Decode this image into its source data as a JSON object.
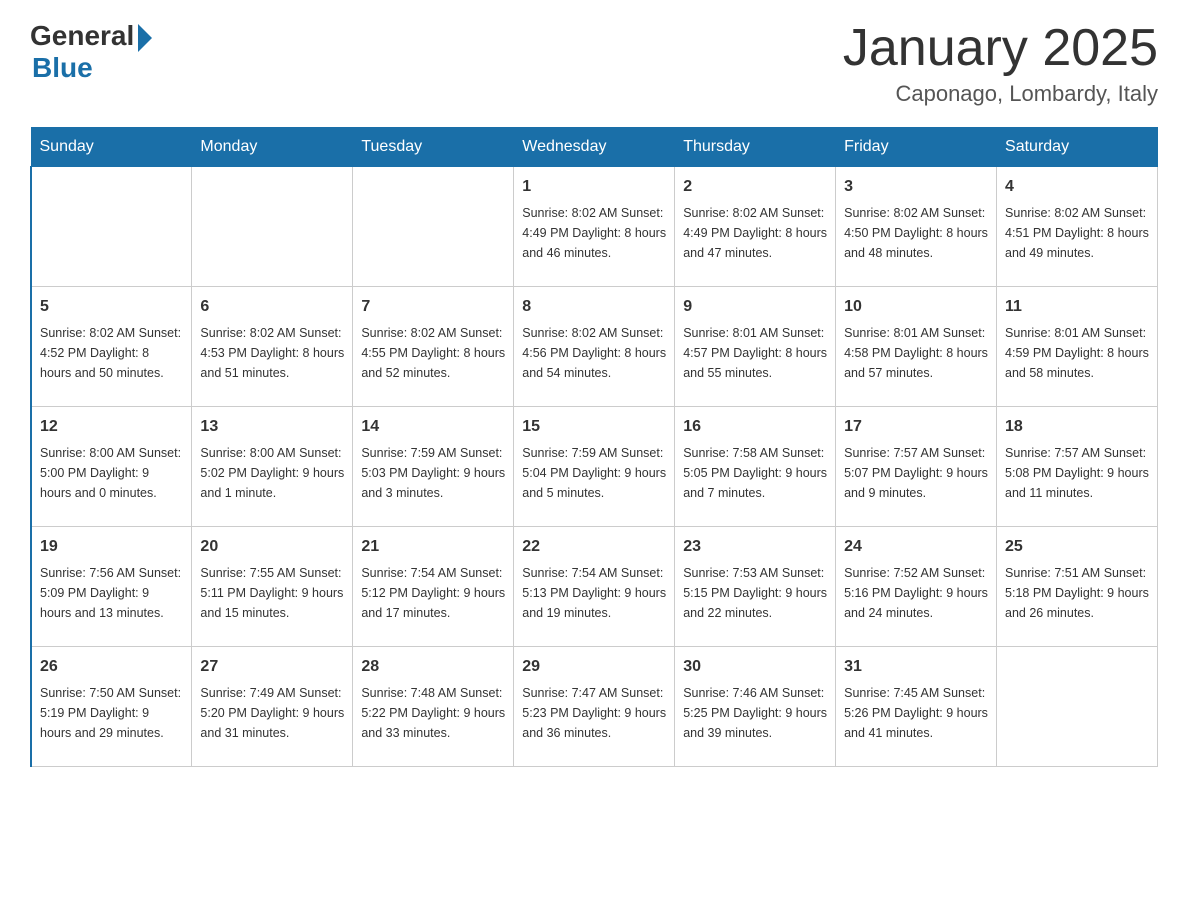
{
  "header": {
    "logo_general": "General",
    "logo_blue": "Blue",
    "month_title": "January 2025",
    "location": "Caponago, Lombardy, Italy"
  },
  "days_of_week": [
    "Sunday",
    "Monday",
    "Tuesday",
    "Wednesday",
    "Thursday",
    "Friday",
    "Saturday"
  ],
  "weeks": [
    [
      {
        "day": "",
        "info": ""
      },
      {
        "day": "",
        "info": ""
      },
      {
        "day": "",
        "info": ""
      },
      {
        "day": "1",
        "info": "Sunrise: 8:02 AM\nSunset: 4:49 PM\nDaylight: 8 hours\nand 46 minutes."
      },
      {
        "day": "2",
        "info": "Sunrise: 8:02 AM\nSunset: 4:49 PM\nDaylight: 8 hours\nand 47 minutes."
      },
      {
        "day": "3",
        "info": "Sunrise: 8:02 AM\nSunset: 4:50 PM\nDaylight: 8 hours\nand 48 minutes."
      },
      {
        "day": "4",
        "info": "Sunrise: 8:02 AM\nSunset: 4:51 PM\nDaylight: 8 hours\nand 49 minutes."
      }
    ],
    [
      {
        "day": "5",
        "info": "Sunrise: 8:02 AM\nSunset: 4:52 PM\nDaylight: 8 hours\nand 50 minutes."
      },
      {
        "day": "6",
        "info": "Sunrise: 8:02 AM\nSunset: 4:53 PM\nDaylight: 8 hours\nand 51 minutes."
      },
      {
        "day": "7",
        "info": "Sunrise: 8:02 AM\nSunset: 4:55 PM\nDaylight: 8 hours\nand 52 minutes."
      },
      {
        "day": "8",
        "info": "Sunrise: 8:02 AM\nSunset: 4:56 PM\nDaylight: 8 hours\nand 54 minutes."
      },
      {
        "day": "9",
        "info": "Sunrise: 8:01 AM\nSunset: 4:57 PM\nDaylight: 8 hours\nand 55 minutes."
      },
      {
        "day": "10",
        "info": "Sunrise: 8:01 AM\nSunset: 4:58 PM\nDaylight: 8 hours\nand 57 minutes."
      },
      {
        "day": "11",
        "info": "Sunrise: 8:01 AM\nSunset: 4:59 PM\nDaylight: 8 hours\nand 58 minutes."
      }
    ],
    [
      {
        "day": "12",
        "info": "Sunrise: 8:00 AM\nSunset: 5:00 PM\nDaylight: 9 hours\nand 0 minutes."
      },
      {
        "day": "13",
        "info": "Sunrise: 8:00 AM\nSunset: 5:02 PM\nDaylight: 9 hours\nand 1 minute."
      },
      {
        "day": "14",
        "info": "Sunrise: 7:59 AM\nSunset: 5:03 PM\nDaylight: 9 hours\nand 3 minutes."
      },
      {
        "day": "15",
        "info": "Sunrise: 7:59 AM\nSunset: 5:04 PM\nDaylight: 9 hours\nand 5 minutes."
      },
      {
        "day": "16",
        "info": "Sunrise: 7:58 AM\nSunset: 5:05 PM\nDaylight: 9 hours\nand 7 minutes."
      },
      {
        "day": "17",
        "info": "Sunrise: 7:57 AM\nSunset: 5:07 PM\nDaylight: 9 hours\nand 9 minutes."
      },
      {
        "day": "18",
        "info": "Sunrise: 7:57 AM\nSunset: 5:08 PM\nDaylight: 9 hours\nand 11 minutes."
      }
    ],
    [
      {
        "day": "19",
        "info": "Sunrise: 7:56 AM\nSunset: 5:09 PM\nDaylight: 9 hours\nand 13 minutes."
      },
      {
        "day": "20",
        "info": "Sunrise: 7:55 AM\nSunset: 5:11 PM\nDaylight: 9 hours\nand 15 minutes."
      },
      {
        "day": "21",
        "info": "Sunrise: 7:54 AM\nSunset: 5:12 PM\nDaylight: 9 hours\nand 17 minutes."
      },
      {
        "day": "22",
        "info": "Sunrise: 7:54 AM\nSunset: 5:13 PM\nDaylight: 9 hours\nand 19 minutes."
      },
      {
        "day": "23",
        "info": "Sunrise: 7:53 AM\nSunset: 5:15 PM\nDaylight: 9 hours\nand 22 minutes."
      },
      {
        "day": "24",
        "info": "Sunrise: 7:52 AM\nSunset: 5:16 PM\nDaylight: 9 hours\nand 24 minutes."
      },
      {
        "day": "25",
        "info": "Sunrise: 7:51 AM\nSunset: 5:18 PM\nDaylight: 9 hours\nand 26 minutes."
      }
    ],
    [
      {
        "day": "26",
        "info": "Sunrise: 7:50 AM\nSunset: 5:19 PM\nDaylight: 9 hours\nand 29 minutes."
      },
      {
        "day": "27",
        "info": "Sunrise: 7:49 AM\nSunset: 5:20 PM\nDaylight: 9 hours\nand 31 minutes."
      },
      {
        "day": "28",
        "info": "Sunrise: 7:48 AM\nSunset: 5:22 PM\nDaylight: 9 hours\nand 33 minutes."
      },
      {
        "day": "29",
        "info": "Sunrise: 7:47 AM\nSunset: 5:23 PM\nDaylight: 9 hours\nand 36 minutes."
      },
      {
        "day": "30",
        "info": "Sunrise: 7:46 AM\nSunset: 5:25 PM\nDaylight: 9 hours\nand 39 minutes."
      },
      {
        "day": "31",
        "info": "Sunrise: 7:45 AM\nSunset: 5:26 PM\nDaylight: 9 hours\nand 41 minutes."
      },
      {
        "day": "",
        "info": ""
      }
    ]
  ]
}
